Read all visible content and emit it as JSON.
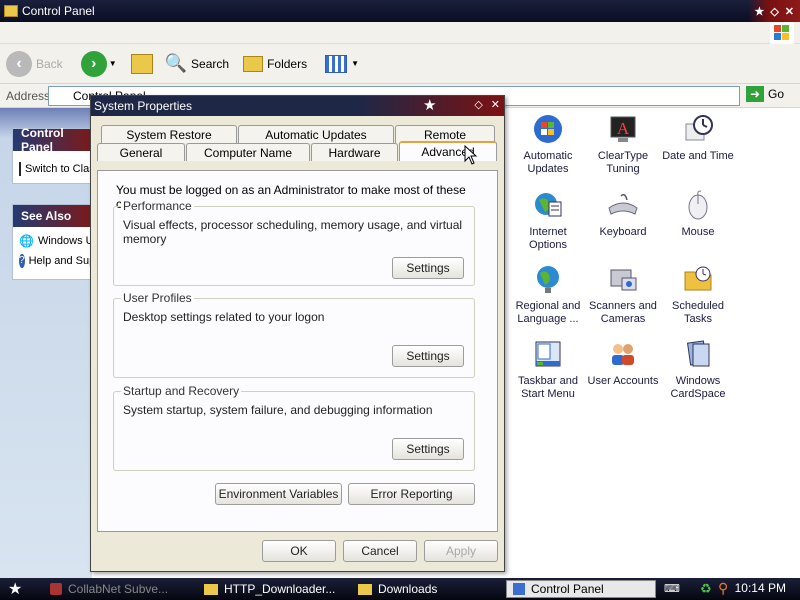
{
  "window": {
    "title": "Control Panel"
  },
  "toolbar": {
    "back_label": "Back",
    "search_label": "Search",
    "folders_label": "Folders"
  },
  "address": {
    "label": "Address",
    "value": "Control Panel",
    "go_label": "Go"
  },
  "taskpane": {
    "control_header": "Control Panel",
    "switch_label": "Switch to Classic View",
    "see_also_header": "See Also",
    "windows_update_label": "Windows Update",
    "help_label": "Help and Support"
  },
  "icons": [
    {
      "label": "Automatic Updates",
      "icon": "windows-flag-icon"
    },
    {
      "label": "ClearType Tuning",
      "icon": "cleartype-icon"
    },
    {
      "label": "Date and Time",
      "icon": "clock-icon"
    },
    {
      "label": "Internet Options",
      "icon": "globe-icon"
    },
    {
      "label": "Keyboard",
      "icon": "keyboard-icon"
    },
    {
      "label": "Mouse",
      "icon": "mouse-icon"
    },
    {
      "label": "Regional and Language ...",
      "icon": "regional-globe-icon"
    },
    {
      "label": "Scanners and Cameras",
      "icon": "scanner-icon"
    },
    {
      "label": "Scheduled Tasks",
      "icon": "scheduled-tasks-icon"
    },
    {
      "label": "Taskbar and Start Menu",
      "icon": "taskbar-icon"
    },
    {
      "label": "User Accounts",
      "icon": "users-icon"
    },
    {
      "label": "Windows CardSpace",
      "icon": "cardspace-icon"
    }
  ],
  "dialog": {
    "title": "System Properties",
    "tabs_top": [
      "System Restore",
      "Automatic Updates",
      "Remote"
    ],
    "tabs_bottom": [
      "General",
      "Computer Name",
      "Hardware",
      "Advanced"
    ],
    "active_tab": "Advanced",
    "admin_note": "You must be logged on as an Administrator to make most of these changes.",
    "performance": {
      "title": "Performance",
      "desc": "Visual effects, processor scheduling, memory usage, and virtual memory",
      "button": "Settings"
    },
    "profiles": {
      "title": "User Profiles",
      "desc": "Desktop settings related to your logon",
      "button": "Settings"
    },
    "startup": {
      "title": "Startup and Recovery",
      "desc": "System startup, system failure, and debugging information",
      "button": "Settings"
    },
    "env_button": "Environment Variables",
    "error_button": "Error Reporting",
    "ok": "OK",
    "cancel": "Cancel",
    "apply": "Apply"
  },
  "taskbar": {
    "tasks": [
      "CollabNet Subve...",
      "HTTP_Downloader...",
      "Downloads",
      "Control Panel"
    ],
    "clock": "10:14 PM"
  },
  "colors": {
    "title_bar": "#1a1f3c",
    "accent_red": "#7a1212",
    "dialog_bg": "#ece9d8",
    "tab_highlight": "#e6a33a"
  }
}
